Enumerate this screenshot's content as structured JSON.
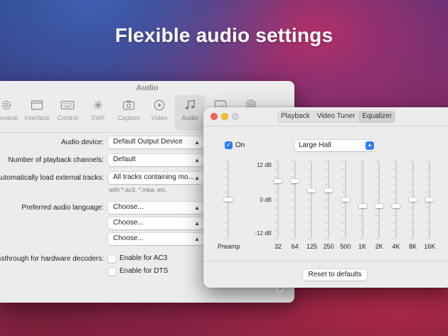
{
  "headline": "Flexible audio settings",
  "audio_window": {
    "title": "Audio",
    "toolbar": [
      {
        "label": "General",
        "icon": "gear-icon",
        "active": false
      },
      {
        "label": "Interface",
        "icon": "window-icon",
        "active": false
      },
      {
        "label": "Control",
        "icon": "keyboard-icon",
        "active": false
      },
      {
        "label": "SWF",
        "icon": "swf-icon",
        "active": false
      },
      {
        "label": "Capture",
        "icon": "camera-icon",
        "active": false
      },
      {
        "label": "Video",
        "icon": "play-icon",
        "active": false
      },
      {
        "label": "Audio",
        "icon": "music-note-icon",
        "active": true
      },
      {
        "label": "",
        "icon": "subtitles-icon",
        "active": false
      },
      {
        "label": "",
        "icon": "airplay-icon",
        "active": false
      }
    ],
    "audio_device": {
      "label": "Audio device:",
      "value": "Default Output Device"
    },
    "playback_channels": {
      "label": "Number of playback channels:",
      "value": "Default"
    },
    "external_tracks": {
      "label": "Automatically load external tracks:",
      "value": "All tracks containing mo...",
      "hint": "with *.ac3, *.mka, etc."
    },
    "preferred_language": {
      "label": "Preferred audio language:",
      "values": [
        "Choose...",
        "Choose...",
        "Choose..."
      ]
    },
    "passthrough": {
      "label": "Passthrough for hardware decoders:",
      "ac3": "Enable for AC3",
      "dts": "Enable for DTS"
    },
    "help": "?"
  },
  "eq_window": {
    "tabs": [
      {
        "label": "Playback",
        "active": false
      },
      {
        "label": "Video Tuner",
        "active": false
      },
      {
        "label": "Equalizer",
        "active": true
      }
    ],
    "on_label": "On",
    "on_checked": true,
    "preset": "Large Hall",
    "db_labels": {
      "top": "12 dB",
      "mid": "0 dB",
      "bottom": "-12 dB"
    },
    "preamp_label": "Preamp",
    "preamp_value": 0,
    "bands": [
      {
        "label": "32",
        "value": 6
      },
      {
        "label": "64",
        "value": 6
      },
      {
        "label": "125",
        "value": 3
      },
      {
        "label": "250",
        "value": 3
      },
      {
        "label": "500",
        "value": 0
      },
      {
        "label": "1K",
        "value": -2
      },
      {
        "label": "2K",
        "value": -2
      },
      {
        "label": "4K",
        "value": -2
      },
      {
        "label": "8K",
        "value": 0
      },
      {
        "label": "16K",
        "value": 0
      }
    ],
    "reset_label": "Reset to defaults"
  },
  "colors": {
    "accent": "#2f7cf6",
    "close": "#fe5f57",
    "minimize": "#febc2e"
  }
}
